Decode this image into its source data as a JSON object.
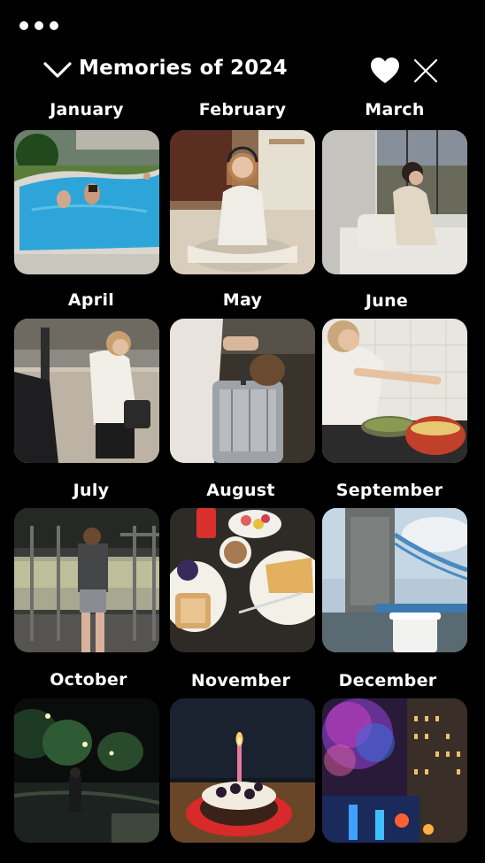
{
  "header": {
    "title": "Memories of 2024"
  },
  "months": [
    {
      "label": "January",
      "photo": "pool-photo"
    },
    {
      "label": "February",
      "photo": "meditation-photo"
    },
    {
      "label": "March",
      "photo": "window-sofa-photo"
    },
    {
      "label": "April",
      "photo": "street-photo"
    },
    {
      "label": "May",
      "photo": "suitcase-photo"
    },
    {
      "label": "June",
      "photo": "cooking-photo"
    },
    {
      "label": "July",
      "photo": "gym-photo"
    },
    {
      "label": "August",
      "photo": "breakfast-photo"
    },
    {
      "label": "September",
      "photo": "tower-bridge-photo"
    },
    {
      "label": "October",
      "photo": "night-rain-photo"
    },
    {
      "label": "November",
      "photo": "birthday-cake-photo"
    },
    {
      "label": "December",
      "photo": "fireworks-photo"
    }
  ]
}
